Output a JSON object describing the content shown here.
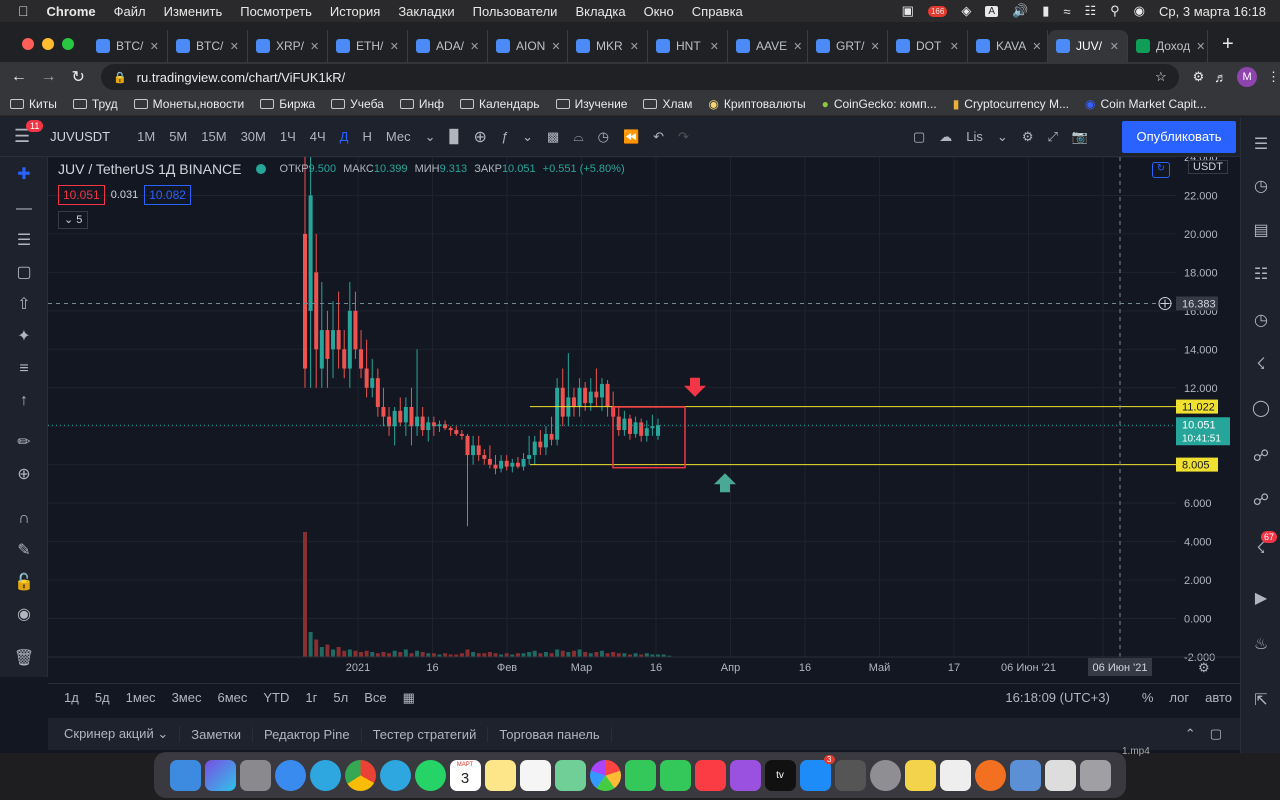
{
  "menubar": {
    "app": "Chrome",
    "items": [
      "Файл",
      "Изменить",
      "Посмотреть",
      "История",
      "Закладки",
      "Пользователи",
      "Вкладка",
      "Окно",
      "Справка"
    ],
    "badge": "166",
    "datetime": "Ср, 3 марта  16:18"
  },
  "tabs": [
    {
      "label": "BTC/"
    },
    {
      "label": "BTC/"
    },
    {
      "label": "XRP/"
    },
    {
      "label": "ETH/"
    },
    {
      "label": "ADA/"
    },
    {
      "label": "AION"
    },
    {
      "label": "MKR"
    },
    {
      "label": "HNT"
    },
    {
      "label": "AAVE"
    },
    {
      "label": "GRT/"
    },
    {
      "label": "DOT"
    },
    {
      "label": "KAVA"
    },
    {
      "label": "JUV/",
      "active": true
    },
    {
      "label": "Доход"
    }
  ],
  "url": "ru.tradingview.com/chart/ViFUK1kR/",
  "profile": "M",
  "bookmarks": [
    "Киты",
    "Труд",
    "Монеты,новости",
    "Биржа",
    "Учеба",
    "Инф",
    "Календарь",
    "Изучение",
    "Хлам",
    "Криптовалюты",
    "CoinGecko: комп...",
    "Cryptocurrency M...",
    "Coin Market Capit..."
  ],
  "toolbar": {
    "symbol": "JUVUSDT",
    "intervals": [
      "1М",
      "5М",
      "15М",
      "30М",
      "1Ч",
      "4Ч",
      "Д",
      "Н",
      "Мес"
    ],
    "active_interval": "Д",
    "layout": "Lis",
    "publish": "Опубликовать",
    "menu_badge": "11"
  },
  "legend": {
    "title": "JUV / TetherUS  1Д  BINANCE",
    "open_label": "ОТКР",
    "open": "9.500",
    "high_label": "МАКС",
    "high": "10.399",
    "low_label": "МИН",
    "low": "9.313",
    "close_label": "ЗАКР",
    "close": "10.051",
    "change": "+0.551 (+5.80%)",
    "bid": "10.051",
    "spread": "0.031",
    "ask": "10.082",
    "indicators": "5"
  },
  "chart_data": {
    "type": "candlestick",
    "title": "JUV / TetherUS  1Д  BINANCE",
    "currency": "USDT",
    "y_ticks": [
      "-2.000",
      "0.000",
      "2.000",
      "4.000",
      "6.000",
      "8.000",
      "10.000",
      "12.000",
      "14.000",
      "16.000",
      "18.000",
      "20.000",
      "22.000",
      "24.000"
    ],
    "y_range": [
      -2,
      24
    ],
    "x_ticks": [
      "2021",
      "16",
      "Фев",
      "Мар",
      "16",
      "Апр",
      "16",
      "Май",
      "17",
      "06 Июн '21",
      "16"
    ],
    "levels": [
      {
        "label": "11.022",
        "value": 11.022,
        "color": "#f0e130"
      },
      {
        "label": "8.005",
        "value": 8.005,
        "color": "#f0e130"
      }
    ],
    "crosshair": {
      "label": "16.383",
      "value": 16.383,
      "date": "06 Июн '21"
    },
    "last_price": {
      "label": "10.051",
      "value": 10.051,
      "countdown": "10:41:51"
    },
    "candles": [
      {
        "o": 20,
        "h": 24.5,
        "l": 12,
        "c": 13
      },
      {
        "o": 16,
        "h": 24,
        "l": 12,
        "c": 22
      },
      {
        "o": 18,
        "h": 20,
        "l": 12,
        "c": 14
      },
      {
        "o": 13,
        "h": 17.5,
        "l": 12,
        "c": 15
      },
      {
        "o": 15,
        "h": 16,
        "l": 12,
        "c": 13.5
      },
      {
        "o": 14,
        "h": 16.5,
        "l": 12.5,
        "c": 15
      },
      {
        "o": 15,
        "h": 17,
        "l": 13,
        "c": 14
      },
      {
        "o": 14,
        "h": 15,
        "l": 12.5,
        "c": 13
      },
      {
        "o": 13,
        "h": 17.5,
        "l": 12,
        "c": 16
      },
      {
        "o": 16,
        "h": 17,
        "l": 13.5,
        "c": 14
      },
      {
        "o": 14,
        "h": 15,
        "l": 12.5,
        "c": 13
      },
      {
        "o": 13,
        "h": 14.5,
        "l": 11.5,
        "c": 12
      },
      {
        "o": 12,
        "h": 13.5,
        "l": 11.5,
        "c": 12.5
      },
      {
        "o": 12.5,
        "h": 13,
        "l": 10.5,
        "c": 11
      },
      {
        "o": 11,
        "h": 12,
        "l": 10,
        "c": 10.5
      },
      {
        "o": 10.5,
        "h": 11,
        "l": 9.5,
        "c": 10
      },
      {
        "o": 10,
        "h": 11,
        "l": 9,
        "c": 10.8
      },
      {
        "o": 10.8,
        "h": 11.5,
        "l": 10,
        "c": 10.2
      },
      {
        "o": 10.2,
        "h": 11.5,
        "l": 9.5,
        "c": 11
      },
      {
        "o": 11,
        "h": 12,
        "l": 9,
        "c": 10
      },
      {
        "o": 10,
        "h": 14,
        "l": 9.5,
        "c": 10.5
      },
      {
        "o": 10.5,
        "h": 11,
        "l": 9.5,
        "c": 9.8
      },
      {
        "o": 9.8,
        "h": 10.5,
        "l": 9.2,
        "c": 10.2
      },
      {
        "o": 10.2,
        "h": 10.5,
        "l": 9.5,
        "c": 10
      },
      {
        "o": 10,
        "h": 10.3,
        "l": 9.7,
        "c": 10.1
      },
      {
        "o": 10.1,
        "h": 10.3,
        "l": 9.8,
        "c": 9.9
      },
      {
        "o": 9.9,
        "h": 10,
        "l": 9.5,
        "c": 9.8
      },
      {
        "o": 9.8,
        "h": 10,
        "l": 9.5,
        "c": 9.6
      },
      {
        "o": 9.6,
        "h": 9.8,
        "l": 9.3,
        "c": 9.5
      },
      {
        "o": 9.5,
        "h": 9.6,
        "l": 4.8,
        "c": 8.5
      },
      {
        "o": 8.5,
        "h": 9.5,
        "l": 8,
        "c": 9
      },
      {
        "o": 9,
        "h": 9.5,
        "l": 8.2,
        "c": 8.5
      },
      {
        "o": 8.5,
        "h": 8.8,
        "l": 8,
        "c": 8.3
      },
      {
        "o": 8.3,
        "h": 9,
        "l": 7.8,
        "c": 8
      },
      {
        "o": 8,
        "h": 8.5,
        "l": 7.5,
        "c": 7.8
      },
      {
        "o": 7.8,
        "h": 8.5,
        "l": 7.6,
        "c": 8.2
      },
      {
        "o": 8.2,
        "h": 8.5,
        "l": 7.7,
        "c": 7.9
      },
      {
        "o": 7.9,
        "h": 8.3,
        "l": 7.6,
        "c": 8.1
      },
      {
        "o": 8.1,
        "h": 8.4,
        "l": 7.8,
        "c": 7.9
      },
      {
        "o": 7.9,
        "h": 8.6,
        "l": 7.7,
        "c": 8.3
      },
      {
        "o": 8.3,
        "h": 9.5,
        "l": 8,
        "c": 8.5
      },
      {
        "o": 8.5,
        "h": 9.5,
        "l": 8,
        "c": 9.2
      },
      {
        "o": 9.2,
        "h": 9.8,
        "l": 8.5,
        "c": 8.9
      },
      {
        "o": 8.9,
        "h": 10,
        "l": 8.5,
        "c": 9.6
      },
      {
        "o": 9.6,
        "h": 10.5,
        "l": 9,
        "c": 9.3
      },
      {
        "o": 9.3,
        "h": 12.5,
        "l": 9,
        "c": 12
      },
      {
        "o": 12,
        "h": 13,
        "l": 10,
        "c": 10.5
      },
      {
        "o": 10.5,
        "h": 13.8,
        "l": 10,
        "c": 11.5
      },
      {
        "o": 11.5,
        "h": 12,
        "l": 10.5,
        "c": 11
      },
      {
        "o": 11,
        "h": 12.5,
        "l": 10.5,
        "c": 12
      },
      {
        "o": 12,
        "h": 12.3,
        "l": 10.8,
        "c": 11.2
      },
      {
        "o": 11.2,
        "h": 12.5,
        "l": 10.8,
        "c": 11.8
      },
      {
        "o": 11.8,
        "h": 13,
        "l": 11,
        "c": 11.5
      },
      {
        "o": 11.5,
        "h": 12.5,
        "l": 10.8,
        "c": 12.2
      },
      {
        "o": 12.2,
        "h": 12.4,
        "l": 10.5,
        "c": 11
      },
      {
        "o": 11,
        "h": 11.8,
        "l": 10,
        "c": 10.5
      },
      {
        "o": 10.5,
        "h": 11,
        "l": 9.5,
        "c": 9.8
      },
      {
        "o": 9.8,
        "h": 10.8,
        "l": 9.5,
        "c": 10.4
      },
      {
        "o": 10.4,
        "h": 10.6,
        "l": 9.3,
        "c": 9.6
      },
      {
        "o": 9.6,
        "h": 10.5,
        "l": 9.4,
        "c": 10.2
      },
      {
        "o": 10.2,
        "h": 10.4,
        "l": 9.2,
        "c": 9.5
      },
      {
        "o": 9.5,
        "h": 10.3,
        "l": 9.2,
        "c": 9.9
      },
      {
        "o": 9.9,
        "h": 10.6,
        "l": 9.5,
        "c": 10
      },
      {
        "o": 9.5,
        "h": 10.4,
        "l": 9.3,
        "c": 10.05
      }
    ],
    "volumes": [
      100,
      20,
      14,
      8,
      10,
      6,
      8,
      5,
      6,
      5,
      4,
      5,
      4,
      3,
      4,
      3,
      5,
      4,
      6,
      3,
      5,
      4,
      3,
      3,
      2,
      3,
      2,
      2,
      3,
      6,
      4,
      3,
      3,
      4,
      3,
      2,
      3,
      2,
      3,
      3,
      4,
      5,
      3,
      4,
      3,
      6,
      5,
      4,
      5,
      6,
      4,
      3,
      4,
      5,
      3,
      4,
      3,
      3,
      2,
      3,
      2,
      3,
      2,
      2,
      2,
      1
    ]
  },
  "bottombar": {
    "ranges": [
      "1д",
      "5д",
      "1мес",
      "3мес",
      "6мес",
      "YTD",
      "1г",
      "5л",
      "Все"
    ],
    "time": "16:18:09 (UTC+3)",
    "pct": "%",
    "log": "лог",
    "auto": "авто"
  },
  "panels": [
    "Скринер акций",
    "Заметки",
    "Редактор Pine",
    "Тестер стратегий",
    "Торговая панель"
  ],
  "right_badge": "67",
  "dock_badges": {
    "calendar": "3",
    "calendar_month": "МАРТ",
    "appstore": "3"
  },
  "dock_overflow": "1.mp4"
}
